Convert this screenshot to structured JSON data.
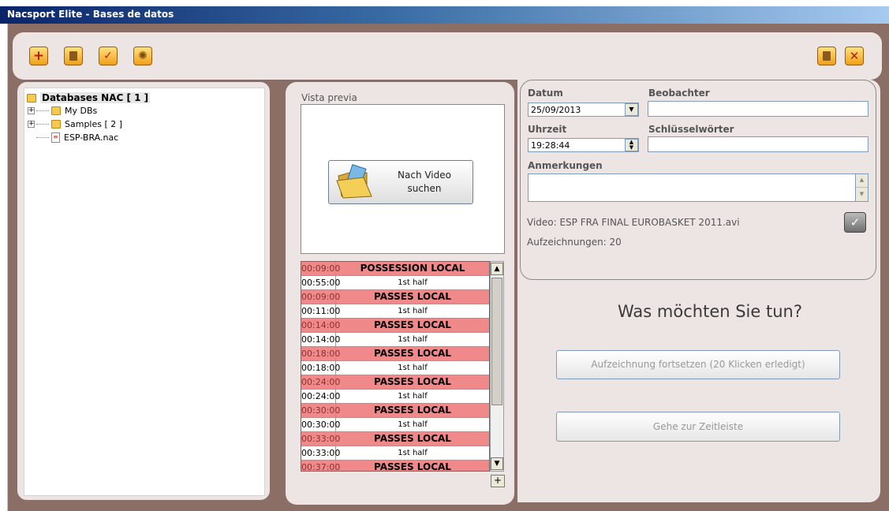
{
  "window": {
    "title": "Nacsport Elite - Bases de datos"
  },
  "toolbar": {
    "left_buttons": [
      "add-icon",
      "trash-icon",
      "check-icon",
      "gear-icon"
    ],
    "right_buttons": [
      "trash-icon",
      "close-icon"
    ]
  },
  "tree": {
    "root_label": "Databases NAC [ 1 ]",
    "items": [
      {
        "label": "My DBs"
      },
      {
        "label": "Samples [ 2 ]"
      },
      {
        "label": "ESP-BRA.nac"
      }
    ]
  },
  "preview": {
    "label": "Vista previa",
    "find_button_line1": "Nach Video",
    "find_button_line2": "suchen"
  },
  "events": [
    {
      "time": "00:09:00",
      "name": "POSSESSION LOCAL",
      "kind": "cat"
    },
    {
      "time": "00:55:00",
      "name": "1st half",
      "kind": "half"
    },
    {
      "time": "00:09:00",
      "name": "PASSES LOCAL",
      "kind": "cat"
    },
    {
      "time": "00:11:00",
      "name": "1st half",
      "kind": "half"
    },
    {
      "time": "00:14:00",
      "name": "PASSES LOCAL",
      "kind": "cat"
    },
    {
      "time": "00:14:00",
      "name": "1st half",
      "kind": "half"
    },
    {
      "time": "00:18:00",
      "name": "PASSES LOCAL",
      "kind": "cat"
    },
    {
      "time": "00:18:00",
      "name": "1st half",
      "kind": "half"
    },
    {
      "time": "00:24:00",
      "name": "PASSES LOCAL",
      "kind": "cat"
    },
    {
      "time": "00:24:00",
      "name": "1st half",
      "kind": "half"
    },
    {
      "time": "00:30:00",
      "name": "PASSES LOCAL",
      "kind": "cat"
    },
    {
      "time": "00:30:00",
      "name": "1st half",
      "kind": "half"
    },
    {
      "time": "00:33:00",
      "name": "PASSES LOCAL",
      "kind": "cat"
    },
    {
      "time": "00:33:00",
      "name": "1st half",
      "kind": "half"
    },
    {
      "time": "00:37:00",
      "name": "PASSES LOCAL",
      "kind": "cat"
    }
  ],
  "list_controls": {
    "scroll_up": "▲",
    "scroll_down": "▼",
    "add": "+"
  },
  "form": {
    "datum_label": "Datum",
    "datum_value": "25/09/2013",
    "beobachter_label": "Beobachter",
    "beobachter_value": "",
    "uhrzeit_label": "Uhrzeit",
    "uhrzeit_value": "19:28:44",
    "schluessel_label": "Schlüsselwörter",
    "schluessel_value": "",
    "anmerkungen_label": "Anmerkungen",
    "anmerkungen_value": "",
    "video_text": "Video: ESP FRA FINAL EUROBASKET 2011.avi",
    "records_text": "Aufzeichnungen: 20"
  },
  "actions": {
    "question": "Was möchten Sie tun?",
    "continue_label": "Aufzeichnung fortsetzen (20 Klicken erledigt)",
    "timeline_label": "Gehe zur Zeitleiste"
  },
  "colors": {
    "frame": "#8b6f66",
    "panel": "#ece5e3",
    "category_row": "#f08a8a",
    "accent_button": "#f0a018"
  }
}
